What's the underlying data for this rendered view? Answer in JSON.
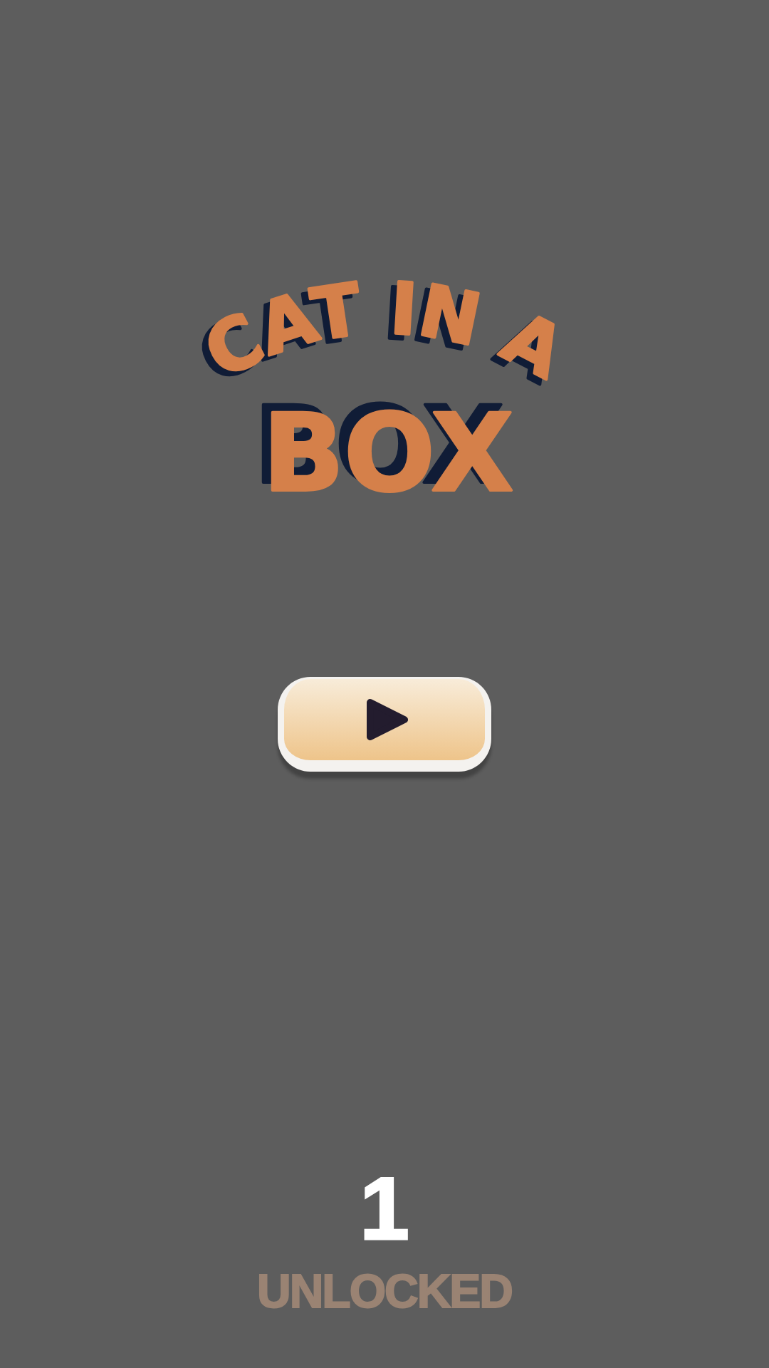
{
  "title": {
    "arc_line": "CAT IN A",
    "main_line": "BOX"
  },
  "progress": {
    "count": "1",
    "label": "UNLOCKED"
  }
}
